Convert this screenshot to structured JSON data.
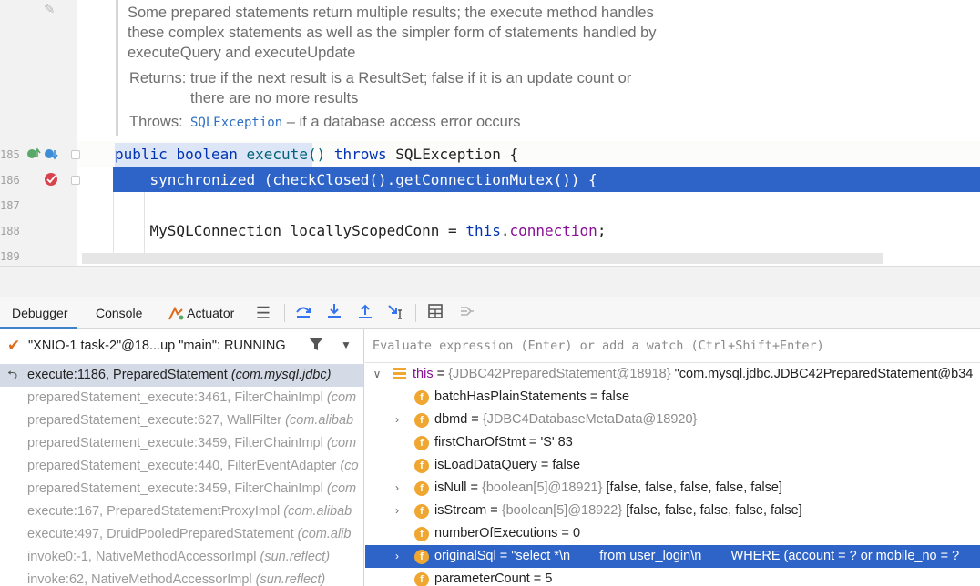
{
  "editor": {
    "doc": {
      "lines": [
        "Some prepared statements return multiple results; the execute method handles",
        "these complex statements as well as the simpler form of statements handled by",
        "executeQuery and executeUpdate"
      ],
      "returns_label": "Returns:",
      "returns_line1": "true if the next result is a ResultSet; false if it is an update count or",
      "returns_line2": "there are no more results",
      "throws_label": "Throws:",
      "throws_code": "SQLException",
      "throws_text": "– if a database access error occurs"
    },
    "line_numbers": [
      "185",
      "186",
      "187",
      "188",
      "189"
    ],
    "code": {
      "l185": {
        "public": "public",
        "boolean": "boolean",
        "execute": "execute()",
        "throws": "throws",
        "rest": " SQLException {"
      },
      "l186": "    synchronized (checkClosed().getConnectionMutex()) {",
      "l188": {
        "type": "    MySQLConnection locallyScopedConn = ",
        "this": "this",
        "dot": ".",
        "field": "connection",
        "end": ";"
      }
    }
  },
  "tabs": {
    "debugger": "Debugger",
    "console": "Console",
    "actuator": "Actuator"
  },
  "frames": {
    "thread": "\"XNIO-1 task-2\"@18...up \"main\": RUNNING",
    "items": [
      {
        "method": "execute:1186, PreparedStatement",
        "cls": "(com.mysql.jdbc)"
      },
      {
        "method": "preparedStatement_execute:3461, FilterChainImpl",
        "cls": "(com"
      },
      {
        "method": "preparedStatement_execute:627, WallFilter",
        "cls": "(com.alibab"
      },
      {
        "method": "preparedStatement_execute:3459, FilterChainImpl",
        "cls": "(com"
      },
      {
        "method": "preparedStatement_execute:440, FilterEventAdapter",
        "cls": "(co"
      },
      {
        "method": "preparedStatement_execute:3459, FilterChainImpl",
        "cls": "(com"
      },
      {
        "method": "execute:167, PreparedStatementProxyImpl",
        "cls": "(com.alibab"
      },
      {
        "method": "execute:497, DruidPooledPreparedStatement",
        "cls": "(com.alib"
      },
      {
        "method": "invoke0:-1, NativeMethodAccessorImpl",
        "cls": "(sun.reflect)"
      },
      {
        "method": "invoke:62, NativeMethodAccessorImpl",
        "cls": "(sun.reflect)"
      }
    ]
  },
  "variables": {
    "eval_placeholder": "Evaluate expression (Enter) or add a watch (Ctrl+Shift+Enter)",
    "this": {
      "name": "this",
      "eq": " = ",
      "ref": "{JDBC42PreparedStatement@18918}",
      "value": " \"com.mysql.jdbc.JDBC42PreparedStatement@b34"
    },
    "fields": [
      {
        "name": "batchHasPlainStatements",
        "eq": " = ",
        "ref": "",
        "value": "false",
        "expandable": false
      },
      {
        "name": "dbmd",
        "eq": " = ",
        "ref": "{JDBC4DatabaseMetaData@18920}",
        "value": "",
        "expandable": true
      },
      {
        "name": "firstCharOfStmt",
        "eq": " = ",
        "ref": "",
        "value": "'S' 83",
        "expandable": false
      },
      {
        "name": "isLoadDataQuery",
        "eq": " = ",
        "ref": "",
        "value": "false",
        "expandable": false
      },
      {
        "name": "isNull",
        "eq": " = ",
        "ref": "{boolean[5]@18921}",
        "value": " [false, false, false, false, false]",
        "expandable": true
      },
      {
        "name": "isStream",
        "eq": " = ",
        "ref": "{boolean[5]@18922}",
        "value": " [false, false, false, false, false]",
        "expandable": true
      },
      {
        "name": "numberOfExecutions",
        "eq": " = ",
        "ref": "",
        "value": "0",
        "expandable": false
      },
      {
        "name": "originalSql",
        "eq": " = ",
        "ref": "",
        "value": "\"select *\\n        from user_login\\n        WHERE (account = ? or mobile_no = ?",
        "expandable": true,
        "selected": true
      },
      {
        "name": "parameterCount",
        "eq": " = ",
        "ref": "",
        "value": "5",
        "expandable": false
      }
    ]
  },
  "icons": {
    "pencil": "pencil-icon",
    "override": "override-icon",
    "breakpoint": "breakpoint-icon"
  }
}
